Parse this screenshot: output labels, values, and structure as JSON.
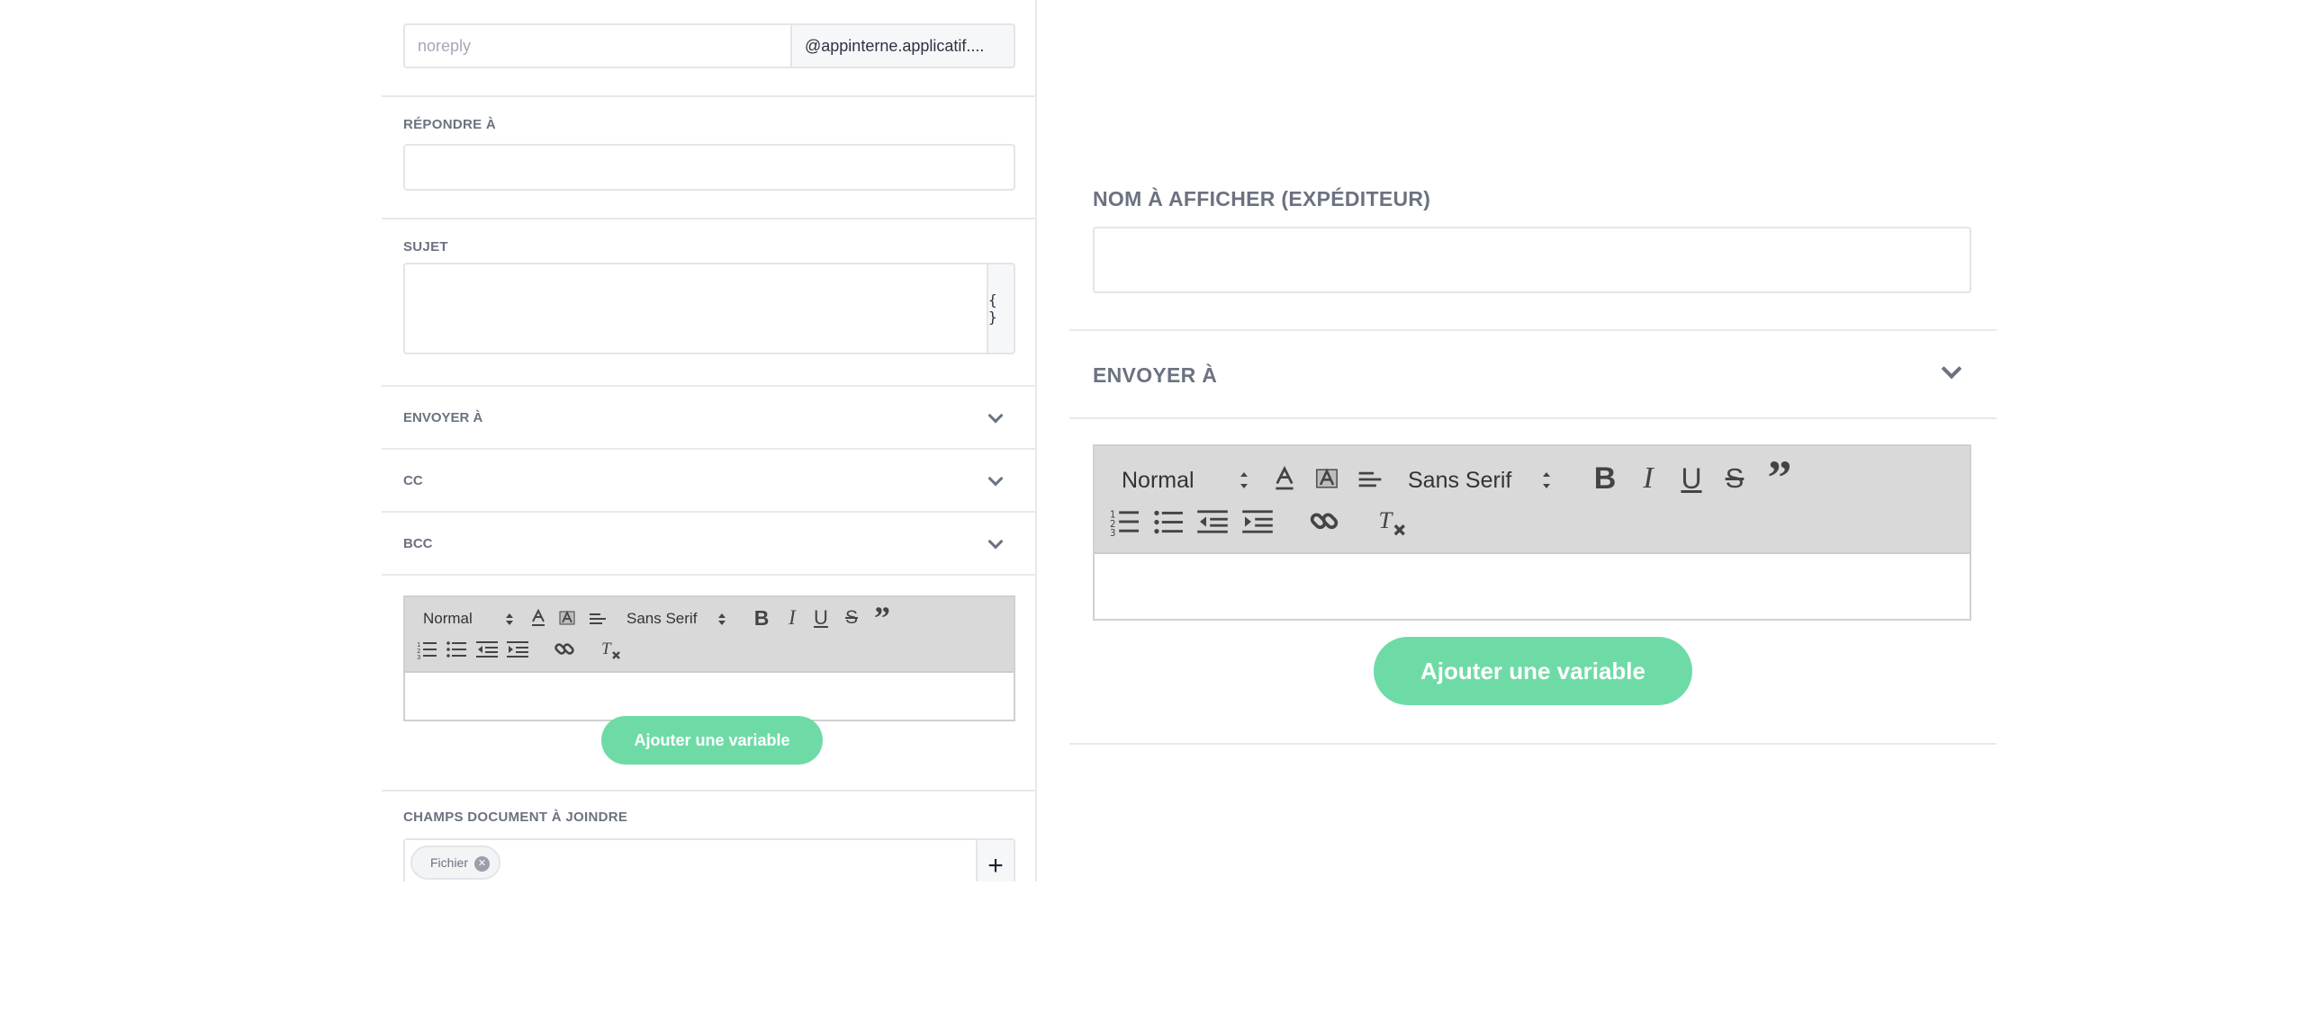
{
  "left": {
    "sender": {
      "local_placeholder": "noreply",
      "domain": "@appinterne.applicatif...."
    },
    "reply_to": {
      "label": "RÉPONDRE À"
    },
    "subject": {
      "label": "SUJET",
      "variable_button": "{ }"
    },
    "accordions": [
      {
        "label": "ENVOYER À"
      },
      {
        "label": "CC"
      },
      {
        "label": "BCC"
      }
    ],
    "editor": {
      "format": "Normal",
      "font": "Sans Serif"
    },
    "add_variable_label": "Ajouter une variable",
    "attachments": {
      "label": "CHAMPS DOCUMENT À JOINDRE",
      "chips": [
        "Fichier"
      ],
      "add_button": "+"
    }
  },
  "right": {
    "display_name": {
      "label": "NOM À AFFICHER (EXPÉDITEUR)"
    },
    "send_to": {
      "label": "ENVOYER À"
    },
    "editor": {
      "format": "Normal",
      "font": "Sans Serif"
    },
    "add_variable_label": "Ajouter une variable"
  },
  "colors": {
    "accent_green": "#6edba6",
    "label_gray": "#6b7280",
    "border": "#e3e5ea",
    "toolbar_bg": "#d9d9d9"
  }
}
